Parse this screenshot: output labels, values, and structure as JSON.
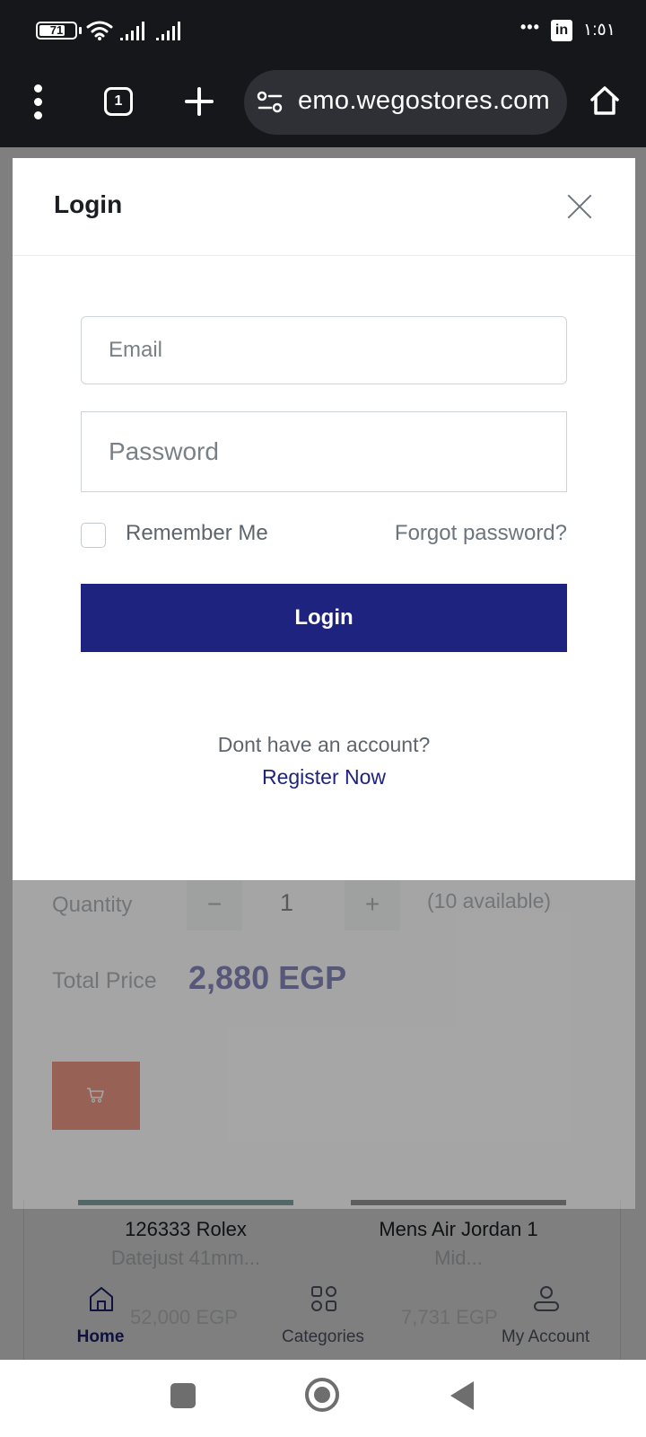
{
  "status_bar": {
    "battery": "71",
    "time": "١:٥١",
    "more_indicator": "•••",
    "linkedin": "in"
  },
  "browser": {
    "tab_count": "1",
    "url": "emo.wegostores.com"
  },
  "page": {
    "quantity_label": "Quantity",
    "quantity_value": "1",
    "quantity_minus": "−",
    "quantity_plus": "+",
    "available": "(10 available)",
    "total_label": "Total Price",
    "total_value": "2,880 EGP",
    "products": [
      {
        "name": "126333 Rolex",
        "subtitle": "Datejust 41mm...",
        "price": "52,000 EGP"
      },
      {
        "name": "Mens Air Jordan 1",
        "subtitle": "Mid...",
        "price": "7,731 EGP"
      }
    ],
    "bottom_nav": [
      {
        "label": "Home",
        "icon": "home-icon",
        "active": true
      },
      {
        "label": "Categories",
        "icon": "categories-icon",
        "active": false
      },
      {
        "label": "My Account",
        "icon": "user-icon",
        "active": false
      }
    ]
  },
  "modal": {
    "title": "Login",
    "email_placeholder": "Email",
    "password_placeholder": "Password",
    "remember_label": "Remember Me",
    "forgot_label": "Forgot password?",
    "login_button": "Login",
    "no_account_text": "Dont have an account?",
    "register_link": "Register Now"
  },
  "colors": {
    "primary": "#1e237f",
    "cart_button": "#d63a1b",
    "status_bar": "#16171b"
  }
}
